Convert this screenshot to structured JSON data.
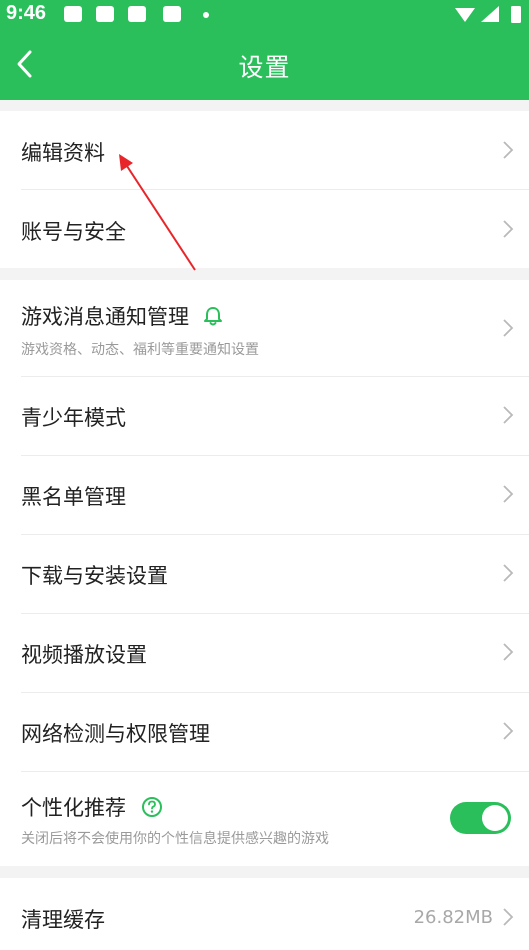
{
  "status_bar": {
    "time": "9:46"
  },
  "app_bar": {
    "title": "设置"
  },
  "section1": [
    {
      "label": "编辑资料"
    },
    {
      "label": "账号与安全"
    }
  ],
  "notify": {
    "label": "游戏消息通知管理",
    "sub": "游戏资格、动态、福利等重要通知设置"
  },
  "section2": [
    {
      "label": "青少年模式"
    },
    {
      "label": "黑名单管理"
    },
    {
      "label": "下载与安装设置"
    },
    {
      "label": "视频播放设置"
    },
    {
      "label": "网络检测与权限管理"
    }
  ],
  "personal": {
    "label": "个性化推荐",
    "sub": "关闭后将不会使用你的个性信息提供感兴趣的游戏",
    "toggle_on": true
  },
  "cache": {
    "label": "清理缓存",
    "value": "26.82MB"
  },
  "colors": {
    "accent": "#2bbf5c",
    "annotation": "#e8262a"
  }
}
